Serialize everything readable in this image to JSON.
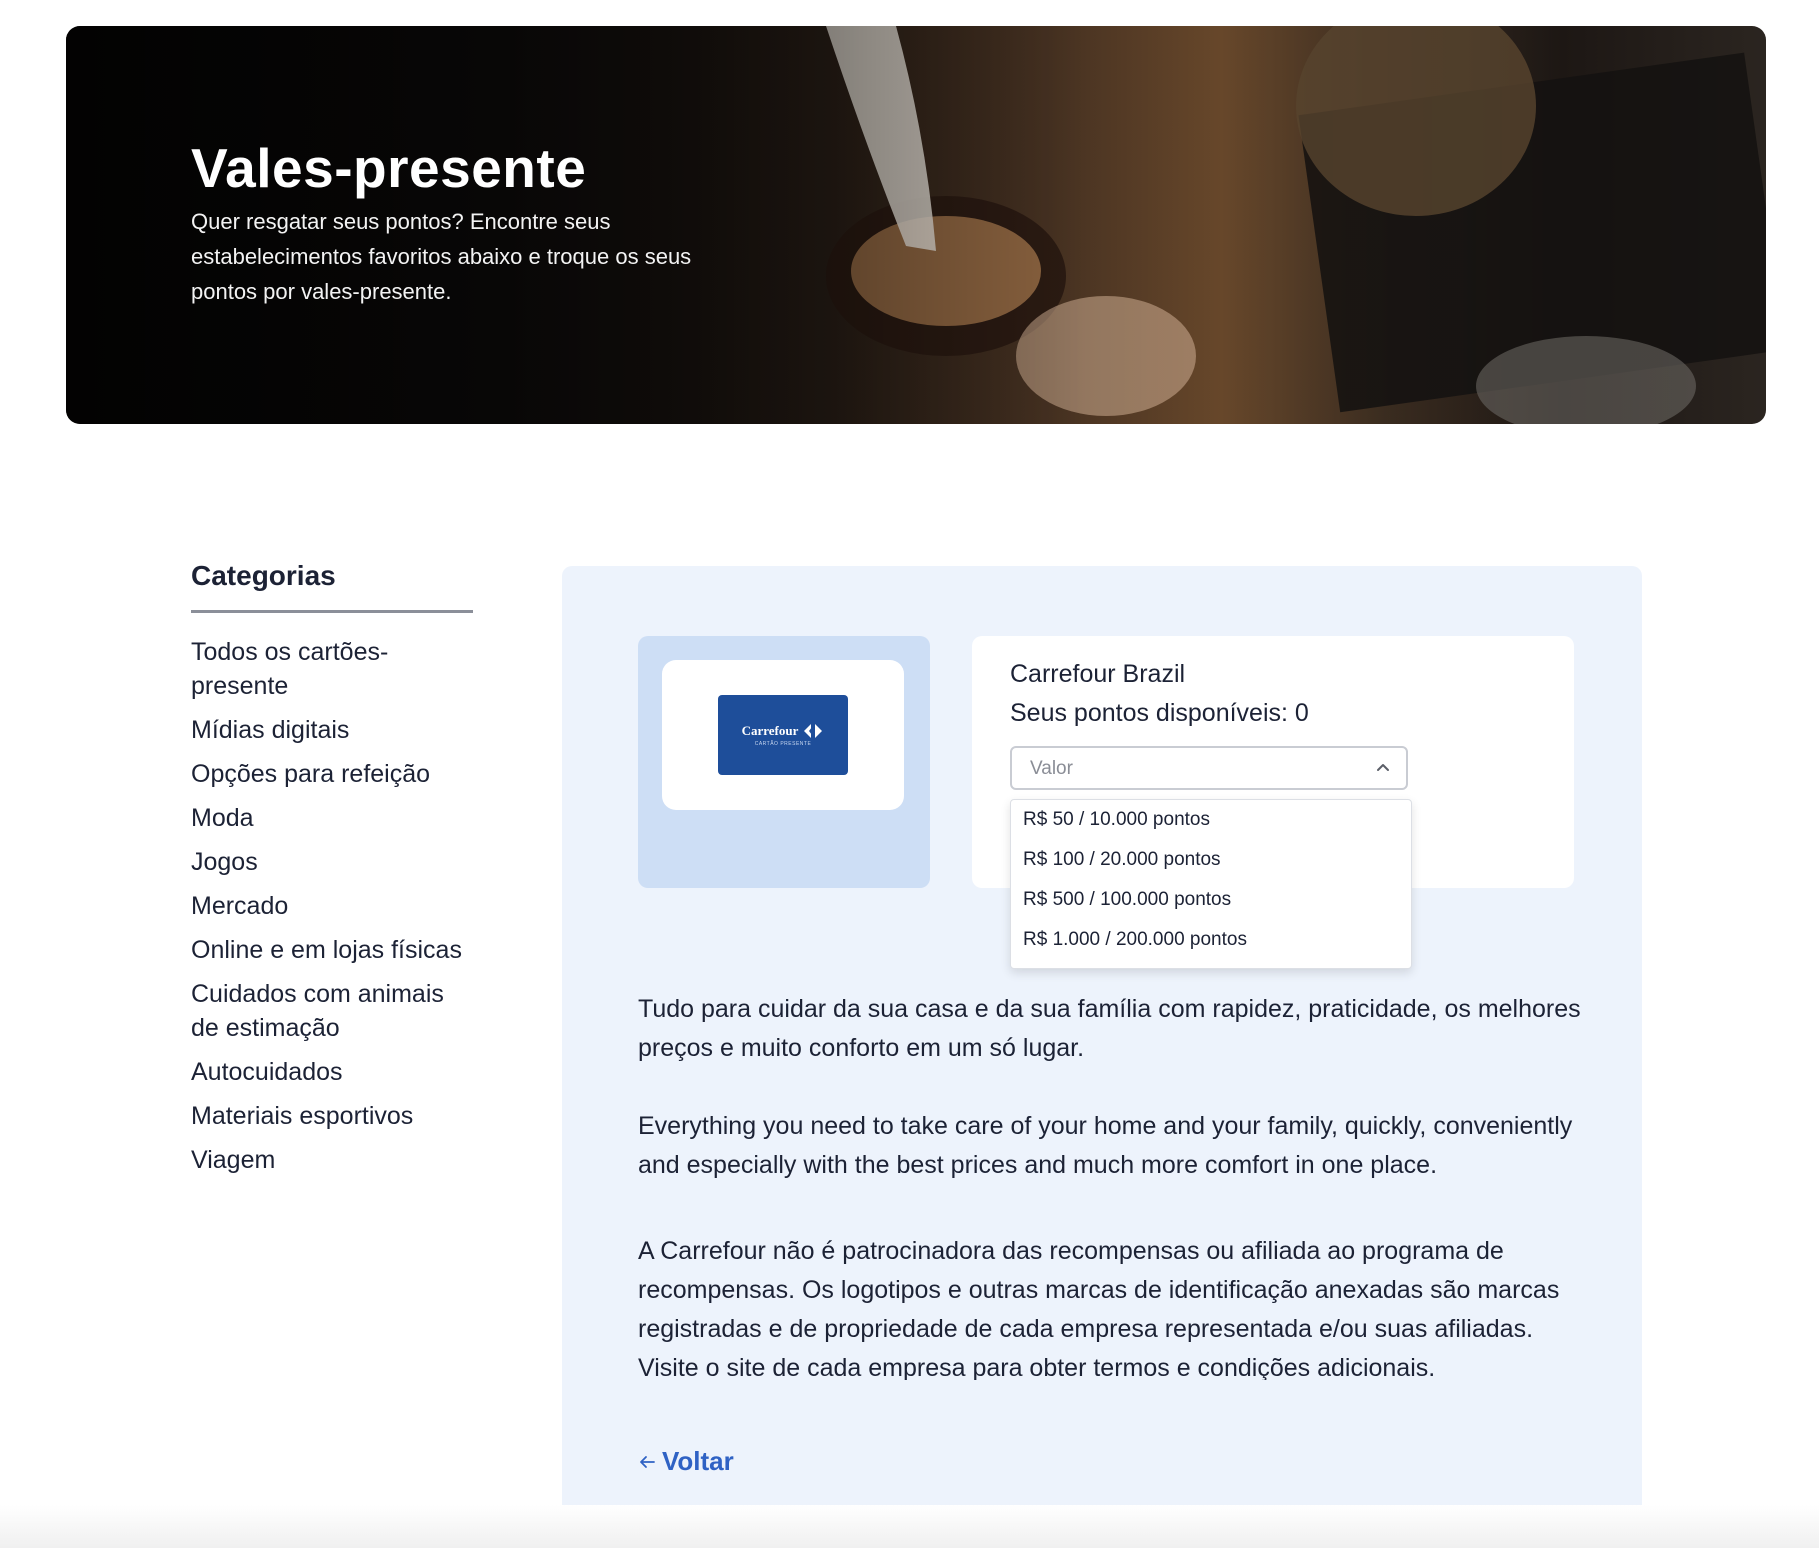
{
  "hero": {
    "title": "Vales-presente",
    "subtitle": "Quer resgatar seus pontos? Encontre seus estabelecimentos favoritos abaixo e troque os seus pontos por vales-presente."
  },
  "sidebar": {
    "title": "Categorias",
    "items": [
      "Todos os cartões-presente",
      "Mídias digitais",
      "Opções para refeição",
      "Moda",
      "Jogos",
      "Mercado",
      "Online e em lojas físicas",
      "Cuidados com animais de estimação",
      "Autocuidados",
      "Materiais esportivos",
      "Viagem"
    ]
  },
  "card": {
    "logo_text": "Carrefour",
    "logo_subtext": "CARTÃO PRESENTE"
  },
  "info": {
    "brand": "Carrefour Brazil",
    "points_label": "Seus pontos disponíveis: 0",
    "select_placeholder": "Valor",
    "options": [
      "R$ 50 / 10.000 pontos",
      "R$ 100 / 20.000 pontos",
      "R$ 500 / 100.000 pontos",
      "R$ 1.000 / 200.000 pontos"
    ]
  },
  "description": {
    "pt": "Tudo para cuidar da sua casa e da sua família com rapidez, praticidade, os melhores preços e muito conforto em um só lugar.",
    "en": "Everything you need to take care of your home and your family, quickly, conveniently and especially with the best prices and much more comfort in one place.",
    "disclaimer": "A Carrefour não é patrocinadora das recompensas ou afiliada ao programa de recompensas. Os logotipos e outras marcas de identificação anexadas são marcas registradas e de propriedade de cada empresa representada e/ou suas afiliadas. Visite o site de cada empresa para obter termos e condições adicionais."
  },
  "back_label": "Voltar",
  "colors": {
    "accent": "#2f62c4",
    "panel_bg": "#edf3fc",
    "card_bg": "#cddef5",
    "logo_bg": "#1e4e9a"
  }
}
